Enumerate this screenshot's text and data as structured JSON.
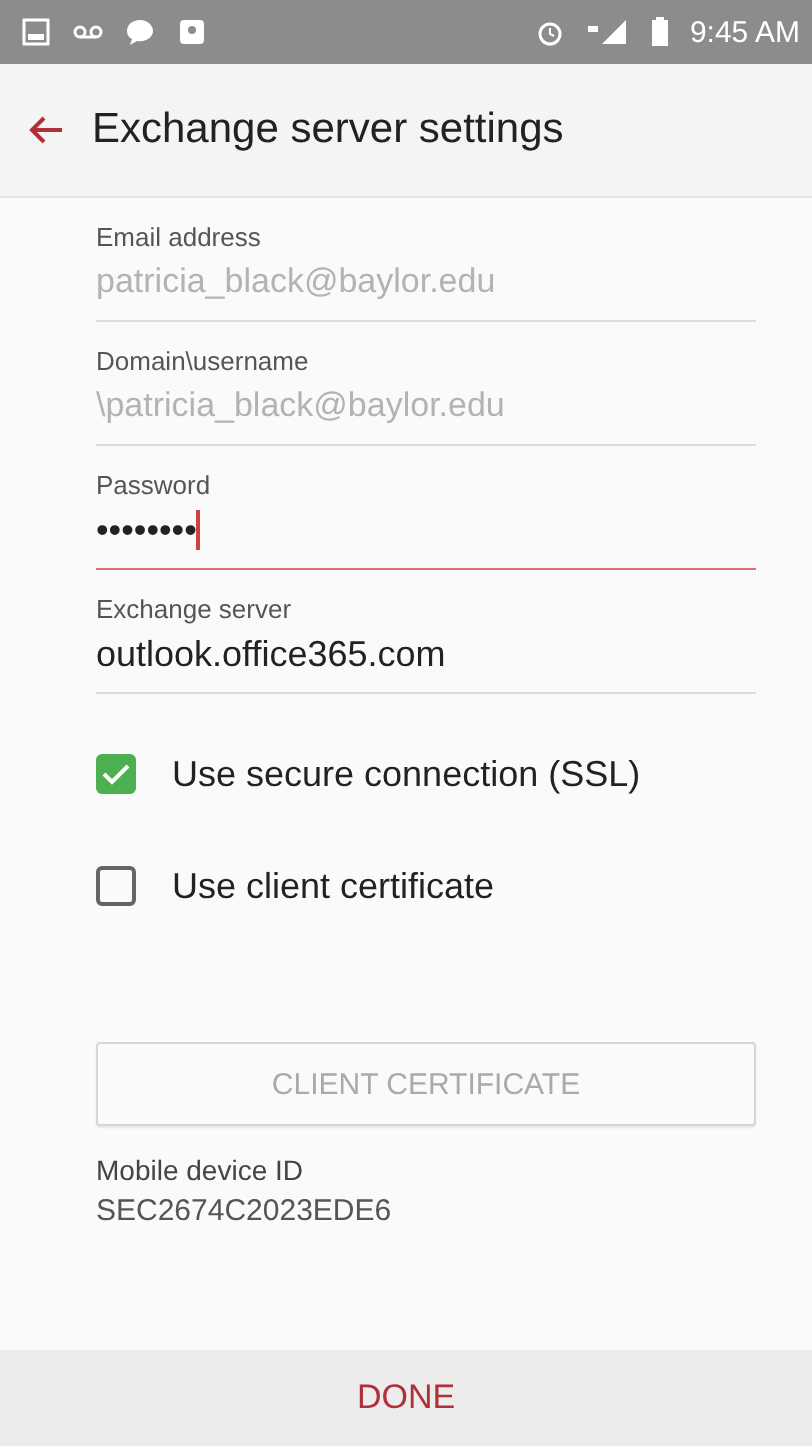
{
  "status_bar": {
    "time": "9:45 AM"
  },
  "header": {
    "title": "Exchange server settings"
  },
  "fields": [
    {
      "label": "Email address",
      "value": "patricia_black@baylor.edu",
      "disabled": true,
      "focused": false
    },
    {
      "label": "Domain\\username",
      "value": "\\patricia_black@baylor.edu",
      "disabled": true,
      "focused": false
    },
    {
      "label": "Password",
      "value": "••••••••",
      "disabled": false,
      "focused": true
    },
    {
      "label": "Exchange server",
      "value": "outlook.office365.com",
      "disabled": false,
      "focused": false
    }
  ],
  "checkboxes": [
    {
      "label": "Use secure connection (SSL)",
      "checked": true
    },
    {
      "label": "Use client certificate",
      "checked": false
    }
  ],
  "certificate_button": {
    "label": "CLIENT CERTIFICATE",
    "disabled": true
  },
  "device_id": {
    "label": "Mobile device ID",
    "value": "SEC2674C2023EDE6"
  },
  "footer": {
    "button": "DONE"
  }
}
